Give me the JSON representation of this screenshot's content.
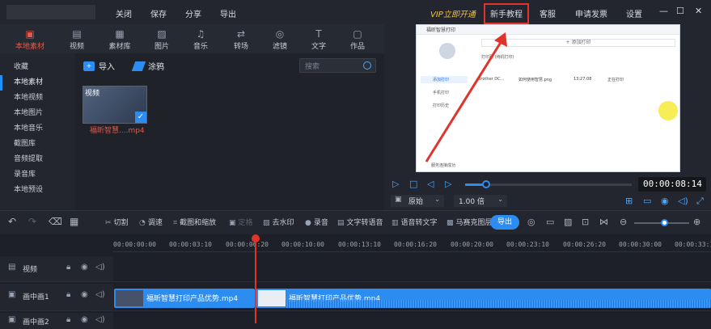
{
  "titlebar": {
    "menus": [
      "关闭",
      "保存",
      "分享",
      "导出"
    ],
    "vip": "VIP立即开通",
    "beginner": "新手教程",
    "service": "客服",
    "invoice": "申请发票",
    "settings": "设置",
    "window_controls": [
      "—",
      "☐",
      "✕"
    ]
  },
  "toolbar": {
    "tools": [
      {
        "label": "本地素材",
        "icon": "folder-icon"
      },
      {
        "label": "视频",
        "icon": "film-icon"
      },
      {
        "label": "素材库",
        "icon": "library-icon"
      },
      {
        "label": "图片",
        "icon": "image-icon"
      },
      {
        "label": "音乐",
        "icon": "music-icon"
      },
      {
        "label": "转场",
        "icon": "transition-icon"
      },
      {
        "label": "滤镜",
        "icon": "filter-icon"
      },
      {
        "label": "文字",
        "icon": "text-icon"
      },
      {
        "label": "作品",
        "icon": "works-icon"
      }
    ]
  },
  "sidebar": {
    "items": [
      "收藏",
      "本地素材",
      "本地视频",
      "本地图片",
      "本地音乐",
      "截图库",
      "音频提取",
      "录音库",
      "本地预设"
    ]
  },
  "library": {
    "import_label": "导入",
    "clear_label": "涂鸦",
    "search_placeholder": "搜索",
    "thumb_badge": "视频",
    "thumb_caption": "福昕智慧....mp4"
  },
  "preview": {
    "app_title": "福昕智慧打印",
    "add_print": "+ 添加打印",
    "list_header": "打印列 (待机打印)",
    "side_items": [
      "添加打印",
      "手机打印",
      "打印历史"
    ],
    "row_device": "Brother DC...",
    "row_file": "如何使用智慧.png",
    "row_time": "13:27:08",
    "row_status": "正在打印",
    "status_text": "服务连接成功",
    "timecode": "00:00:08:14",
    "ratio_label": "原始",
    "speed_label": "1.00 倍"
  },
  "edit_toolbar": {
    "cut": "切割",
    "speed": "调速",
    "crop": "截图和缩放",
    "freeze": "定格",
    "watermark": "去水印",
    "record": "录音",
    "tts": "文字转语音",
    "stt": "语音转文字",
    "mosaic": "马赛克图层",
    "export": "导出"
  },
  "timeline": {
    "ticks": [
      "00:00:00:00",
      "00:00:03:10",
      "00:00:06:20",
      "00:00:10:00",
      "00:00:13:10",
      "00:00:16:20",
      "00:00:20:00",
      "00:00:23:10",
      "00:00:26:20",
      "00:00:30:00",
      "00:00:33:10"
    ],
    "tracks": [
      "视频",
      "画中画1",
      "画中画2"
    ],
    "clip1": "福昕智慧打印产品优势.mp4",
    "clip2": "福昕智慧打印产品优势.mp4"
  }
}
